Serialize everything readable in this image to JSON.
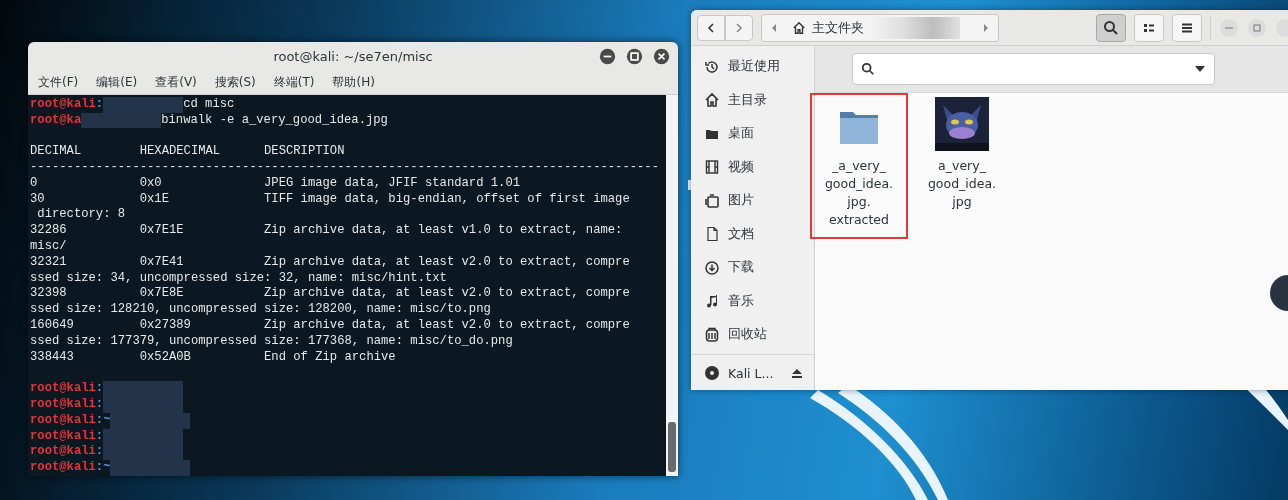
{
  "terminal": {
    "title": "root@kali: ~/se7en/misc",
    "menu": [
      "文件(F)",
      "编辑(E)",
      "查看(V)",
      "搜索(S)",
      "终端(T)",
      "帮助(H)"
    ],
    "lines": [
      {
        "kind": "prompt",
        "user": "root@kali",
        "path": ":",
        "redacted": true,
        "command": "cd misc"
      },
      {
        "kind": "prompt",
        "user": "root@ka",
        "redacted": true,
        "command": "binwalk -e a_very_good_idea.jpg"
      },
      {
        "kind": "blank"
      },
      {
        "kind": "output",
        "text": "DECIMAL        HEXADECIMAL      DESCRIPTION"
      },
      {
        "kind": "output",
        "text": "--------------------------------------------------------------------------------------"
      },
      {
        "kind": "output",
        "text": "0              0x0              JPEG image data, JFIF standard 1.01"
      },
      {
        "kind": "output",
        "text": "30             0x1E             TIFF image data, big-endian, offset of first image"
      },
      {
        "kind": "output",
        "text": " directory: 8"
      },
      {
        "kind": "output",
        "text": "32286          0x7E1E           Zip archive data, at least v1.0 to extract, name:"
      },
      {
        "kind": "output",
        "text": "misc/"
      },
      {
        "kind": "output",
        "text": "32321          0x7E41           Zip archive data, at least v2.0 to extract, compre"
      },
      {
        "kind": "output",
        "text": "ssed size: 34, uncompressed size: 32, name: misc/hint.txt"
      },
      {
        "kind": "output",
        "text": "32398          0x7E8E           Zip archive data, at least v2.0 to extract, compre"
      },
      {
        "kind": "output",
        "text": "ssed size: 128210, uncompressed size: 128200, name: misc/to.png"
      },
      {
        "kind": "output",
        "text": "160649         0x27389          Zip archive data, at least v2.0 to extract, compre"
      },
      {
        "kind": "output",
        "text": "ssed size: 177379, uncompressed size: 177368, name: misc/to_do.png"
      },
      {
        "kind": "output",
        "text": "338443         0x52A0B          End of Zip archive"
      },
      {
        "kind": "blank"
      },
      {
        "kind": "prompt",
        "user": "root@kali",
        "path": ":",
        "redacted": true
      },
      {
        "kind": "prompt",
        "user": "root@kali",
        "path": ":",
        "redacted": true
      },
      {
        "kind": "prompt",
        "user": "root@kali",
        "path": ":~",
        "redacted": true
      },
      {
        "kind": "prompt",
        "user": "root@kali",
        "path": ":",
        "redacted": true
      },
      {
        "kind": "prompt",
        "user": "root@kali",
        "path": ":",
        "redacted": true
      },
      {
        "kind": "prompt",
        "user": "root@kali",
        "path": ":~",
        "redacted": true
      }
    ]
  },
  "files": {
    "path_label": "主文件夹",
    "path_redacted": true,
    "search_selected": true,
    "sidebar": [
      {
        "kind": "recent",
        "label": "最近使用"
      },
      {
        "kind": "home",
        "label": "主目录"
      },
      {
        "kind": "desktop",
        "label": "桌面"
      },
      {
        "kind": "video",
        "label": "视频"
      },
      {
        "kind": "picture",
        "label": "图片"
      },
      {
        "kind": "document",
        "label": "文档"
      },
      {
        "kind": "download",
        "label": "下载"
      },
      {
        "kind": "music",
        "label": "音乐"
      },
      {
        "kind": "trash",
        "label": "回收站"
      }
    ],
    "devices": [
      {
        "kind": "disc",
        "label": "Kali L..."
      }
    ],
    "items": [
      {
        "kind": "folder",
        "name_lines": [
          "_a_very_",
          "good_idea.",
          "jpg.",
          "extracted"
        ],
        "highlighted": true
      },
      {
        "name_lines": [
          "a_very_",
          "good_idea.",
          "jpg"
        ],
        "highlighted": false
      }
    ]
  }
}
